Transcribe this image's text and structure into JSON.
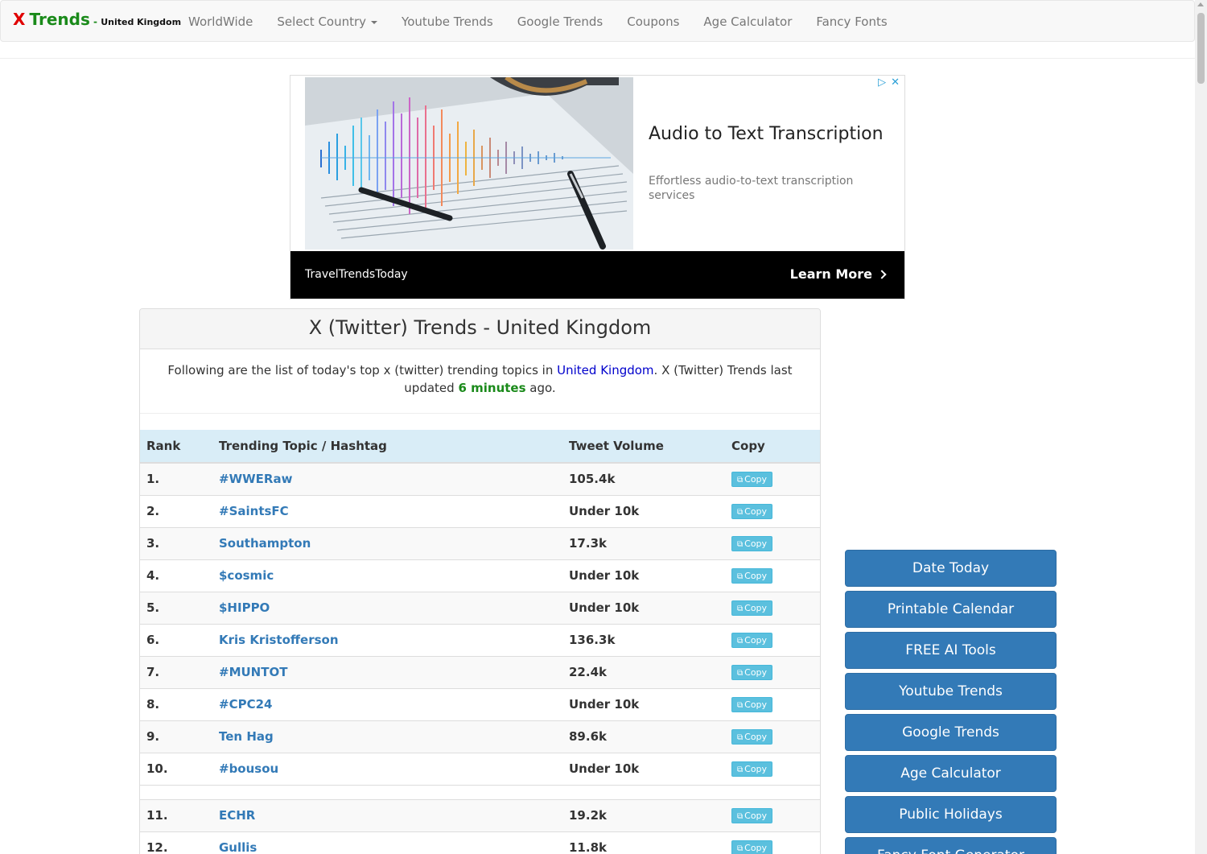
{
  "navbar": {
    "brand_x": "X",
    "brand_trends": "Trends",
    "brand_dash": " - ",
    "brand_country": "United Kingdom",
    "links": [
      "WorldWide",
      "Select Country",
      "Youtube Trends",
      "Google Trends",
      "Coupons",
      "Age Calculator",
      "Fancy Fonts"
    ]
  },
  "ad": {
    "title": "Audio to Text Transcription",
    "description": "Effortless audio-to-text transcription services",
    "advertiser": "TravelTrendsToday",
    "cta": "Learn More",
    "icons": [
      "adchoices-icon",
      "close-icon"
    ]
  },
  "panel": {
    "title": "X (Twitter) Trends - United Kingdom",
    "intro_before": "Following are the list of today's top x (twitter) trending topics in ",
    "intro_country": "United Kingdom",
    "intro_middle": ". X (Twitter) Trends last updated ",
    "intro_minutes": "6 minutes",
    "intro_after": " ago."
  },
  "table": {
    "headers": {
      "rank": "Rank",
      "topic": "Trending Topic / Hashtag",
      "volume": "Tweet Volume",
      "copy": "Copy"
    },
    "copy_label": "Copy",
    "rows": [
      {
        "rank": "1.",
        "topic": "#WWERaw",
        "volume": "105.4k"
      },
      {
        "rank": "2.",
        "topic": "#SaintsFC",
        "volume": "Under 10k"
      },
      {
        "rank": "3.",
        "topic": "Southampton",
        "volume": "17.3k"
      },
      {
        "rank": "4.",
        "topic": "$cosmic",
        "volume": "Under 10k"
      },
      {
        "rank": "5.",
        "topic": "$HIPPO",
        "volume": "Under 10k"
      },
      {
        "rank": "6.",
        "topic": "Kris Kristofferson",
        "volume": "136.3k"
      },
      {
        "rank": "7.",
        "topic": "#MUNTOT",
        "volume": "22.4k"
      },
      {
        "rank": "8.",
        "topic": "#CPC24",
        "volume": "Under 10k"
      },
      {
        "rank": "9.",
        "topic": "Ten Hag",
        "volume": "89.6k"
      },
      {
        "rank": "10.",
        "topic": "#bousou",
        "volume": "Under 10k"
      },
      {
        "rank": "11.",
        "topic": "ECHR",
        "volume": "19.2k"
      },
      {
        "rank": "12.",
        "topic": "Gullis",
        "volume": "11.8k"
      }
    ]
  },
  "side_buttons": [
    "Date Today",
    "Printable Calendar",
    "FREE AI Tools",
    "Youtube Trends",
    "Google Trends",
    "Age Calculator",
    "Public Holidays",
    "Fancy Font Generator"
  ]
}
